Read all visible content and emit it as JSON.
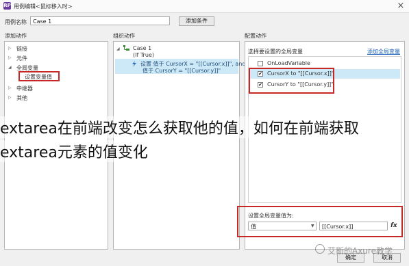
{
  "window": {
    "title": "用例编辑<鼠标移入时>",
    "close_glyph": "×"
  },
  "case_name": {
    "label": "用例名称",
    "value": "Case 1",
    "add_condition_button": "添加条件"
  },
  "add_action": {
    "header": "添加动作",
    "items": [
      {
        "label": "链接",
        "expanded": false
      },
      {
        "label": "元件",
        "expanded": false
      },
      {
        "label": "全局变量",
        "expanded": true
      },
      {
        "label": "设置变量值",
        "child": true
      },
      {
        "label": "中继器",
        "expanded": false
      },
      {
        "label": "其他",
        "expanded": false
      }
    ]
  },
  "organize_action": {
    "header": "组织动作",
    "case_label": "Case 1",
    "case_condition": "(If True)",
    "action_line1": "设置 值于 CursorX = \"[[Cursor.x]]\", and",
    "action_line2": "值于 CursorY = \"[[Cursor.y]]\""
  },
  "configure_action": {
    "header": "配置动作",
    "select_label": "选择要设置的全局变量",
    "add_global_link": "添加全局变量",
    "variables": [
      {
        "label": "OnLoadVariable",
        "checked": false,
        "check_glyph": ""
      },
      {
        "label": "CursorX to \"[[Cursor.x]]\"",
        "checked": true,
        "check_glyph": "✔"
      },
      {
        "label": "CursorY to \"[[Cursor.y]]\"",
        "checked": true,
        "check_glyph": "✔"
      }
    ],
    "set_value_label": "设置全局变量值为:",
    "value_type": "值",
    "value_input": "[[Cursor.x]]",
    "fx_button": "fx"
  },
  "footer": {
    "ok_button": "确定",
    "cancel_button": "取消"
  },
  "overlay": {
    "line1": "extarea在前端改变怎么获取他的值，如何在前端获取",
    "line2": "extarea元素的值变化"
  },
  "watermark": "艾斯的Axure教学",
  "colors": {
    "highlight_red": "#c62828",
    "selection_blue": "#cde8f7",
    "link_blue": "#1a5fb4"
  }
}
